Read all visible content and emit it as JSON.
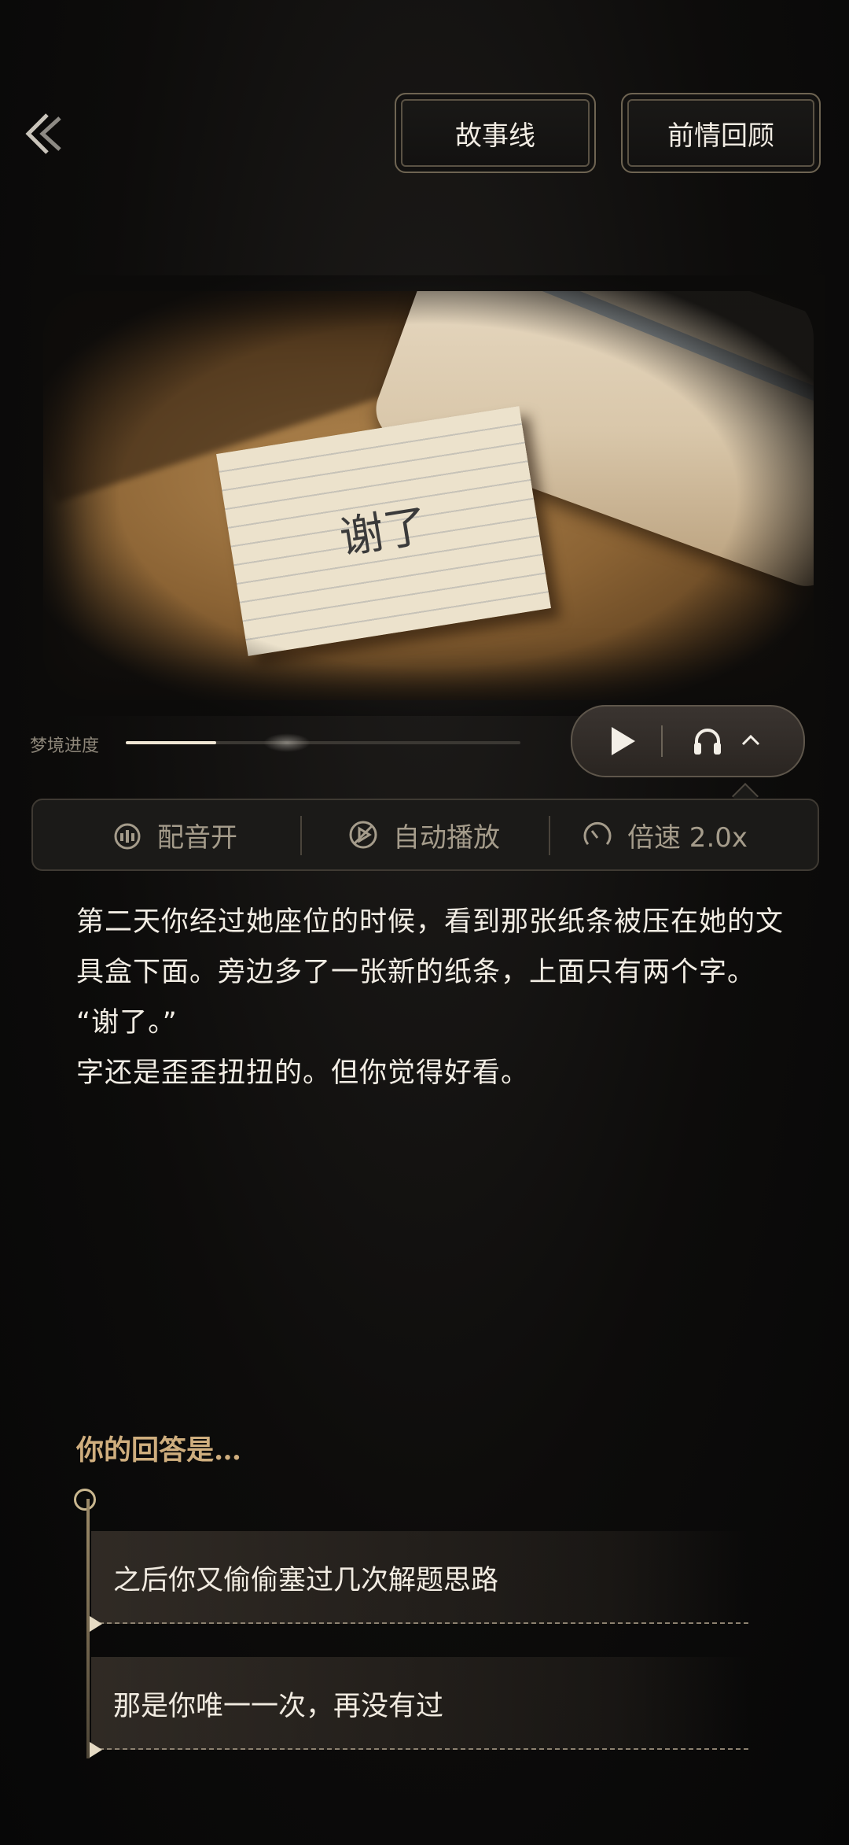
{
  "header": {
    "back_icon": "double-chevron-left-icon",
    "storyline_label": "故事线",
    "recap_label": "前情回顾"
  },
  "scene": {
    "note_text": "谢了"
  },
  "progress": {
    "label": "梦境进度",
    "value": 0.23
  },
  "player": {
    "play_icon": "play-icon",
    "headphones_icon": "headphones-icon",
    "expand_icon": "chevron-up-icon"
  },
  "settings": {
    "dubbing_label": "配音开",
    "autoplay_label": "自动播放",
    "speed_label": "倍速 2.0x"
  },
  "story": {
    "paragraphs": [
      "第二天你经过她座位的时候，看到那张纸条被压在她的文具盒下面。旁边多了一张新的纸条，上面只有两个字。",
      "“谢了。”",
      "字还是歪歪扭扭的。但你觉得好看。"
    ]
  },
  "answers": {
    "heading": "你的回答是…",
    "options": [
      "之后你又偷偷塞过几次解题思路",
      "那是你唯一一次，再没有过"
    ]
  },
  "colors": {
    "accent_gold": "#cfae7e",
    "text_primary": "#f2ede4",
    "text_muted": "#a59c8b"
  }
}
